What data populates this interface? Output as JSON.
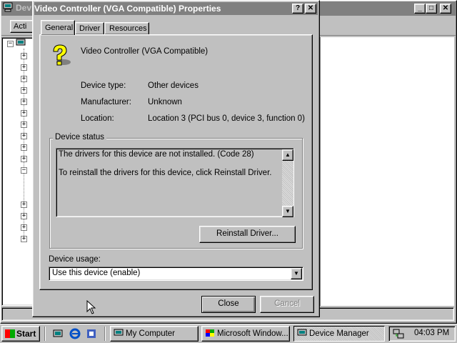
{
  "background_window": {
    "title": "Dev",
    "menu_action": "Acti"
  },
  "dialog": {
    "title": "Video Controller (VGA Compatible) Properties",
    "help_button": "?",
    "close_glyph": "✕",
    "tabs": [
      "General",
      "Driver",
      "Resources"
    ],
    "device_name": "Video Controller (VGA Compatible)",
    "fields": [
      {
        "label": "Device type:",
        "value": "Other devices"
      },
      {
        "label": "Manufacturer:",
        "value": "Unknown"
      },
      {
        "label": "Location:",
        "value": "Location 3 (PCI bus 0, device 3, function 0)"
      }
    ],
    "status_group_label": "Device status",
    "status_lines": [
      "The drivers for this device are not installed. (Code 28)",
      "To reinstall the drivers for this device, click Reinstall Driver."
    ],
    "reinstall_button": "Reinstall Driver...",
    "usage_label": "Device usage:",
    "usage_value": "Use this device (enable)",
    "close_button": "Close",
    "cancel_button": "Cancel"
  },
  "taskbar": {
    "start_label": "Start",
    "tasks": [
      "My Computer",
      "Microsoft Window...",
      "Device Manager"
    ],
    "clock": "04:03 PM"
  },
  "colors": {
    "inactive_title": "#808080",
    "face": "#c0c0c0",
    "window": "#ffffff"
  },
  "icons": [
    "computer-icon",
    "question-device-icon",
    "windows-logo-icon",
    "desktop-icon",
    "ie-icon",
    "channels-icon",
    "network-tray-icon"
  ]
}
